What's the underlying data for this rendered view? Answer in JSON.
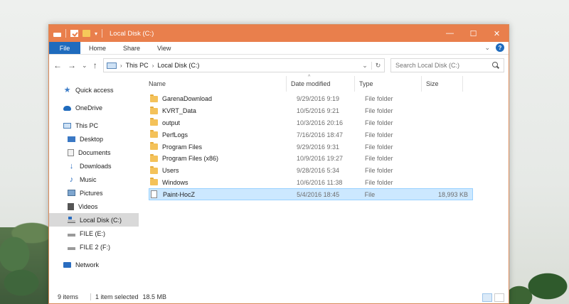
{
  "window": {
    "title": "Local Disk (C:)",
    "controls": {
      "minimize": "—",
      "maximize": "☐",
      "close": "✕"
    }
  },
  "ribbon": {
    "file": "File",
    "tabs": [
      "Home",
      "Share",
      "View"
    ],
    "help": "?"
  },
  "nav": {
    "breadcrumb": [
      "This PC",
      "Local Disk (C:)"
    ],
    "search_placeholder": "Search Local Disk (C:)"
  },
  "sidebar": {
    "items": [
      {
        "label": "Quick access",
        "icon": "star-icon"
      },
      {
        "label": "OneDrive",
        "icon": "cloud-icon"
      },
      {
        "label": "This PC",
        "icon": "computer-icon"
      },
      {
        "label": "Desktop",
        "icon": "desktop-icon"
      },
      {
        "label": "Documents",
        "icon": "documents-icon"
      },
      {
        "label": "Downloads",
        "icon": "download-icon"
      },
      {
        "label": "Music",
        "icon": "music-icon"
      },
      {
        "label": "Pictures",
        "icon": "pictures-icon"
      },
      {
        "label": "Videos",
        "icon": "videos-icon"
      },
      {
        "label": "Local Disk (C:)",
        "icon": "drive-icon"
      },
      {
        "label": "FILE (E:)",
        "icon": "usb-drive-icon"
      },
      {
        "label": "FILE 2 (F:)",
        "icon": "usb-drive-icon"
      },
      {
        "label": "Network",
        "icon": "network-icon"
      }
    ]
  },
  "columns": {
    "name": "Name",
    "date": "Date modified",
    "type": "Type",
    "size": "Size"
  },
  "files": [
    {
      "name": "GarenaDownload",
      "date": "9/29/2016 9:19",
      "type": "File folder",
      "size": ""
    },
    {
      "name": "KVRT_Data",
      "date": "10/5/2016 9:21",
      "type": "File folder",
      "size": ""
    },
    {
      "name": "output",
      "date": "10/3/2016 20:16",
      "type": "File folder",
      "size": ""
    },
    {
      "name": "PerfLogs",
      "date": "7/16/2016 18:47",
      "type": "File folder",
      "size": ""
    },
    {
      "name": "Program Files",
      "date": "9/29/2016 9:31",
      "type": "File folder",
      "size": ""
    },
    {
      "name": "Program Files (x86)",
      "date": "10/9/2016 19:27",
      "type": "File folder",
      "size": ""
    },
    {
      "name": "Users",
      "date": "9/28/2016 5:34",
      "type": "File folder",
      "size": ""
    },
    {
      "name": "Windows",
      "date": "10/6/2016 11:38",
      "type": "File folder",
      "size": ""
    },
    {
      "name": "Paint-HocZ",
      "date": "5/4/2016 18:45",
      "type": "File",
      "size": "18,993 KB"
    }
  ],
  "status": {
    "items": "9 items",
    "selected": "1 item selected",
    "size": "18.5 MB"
  }
}
